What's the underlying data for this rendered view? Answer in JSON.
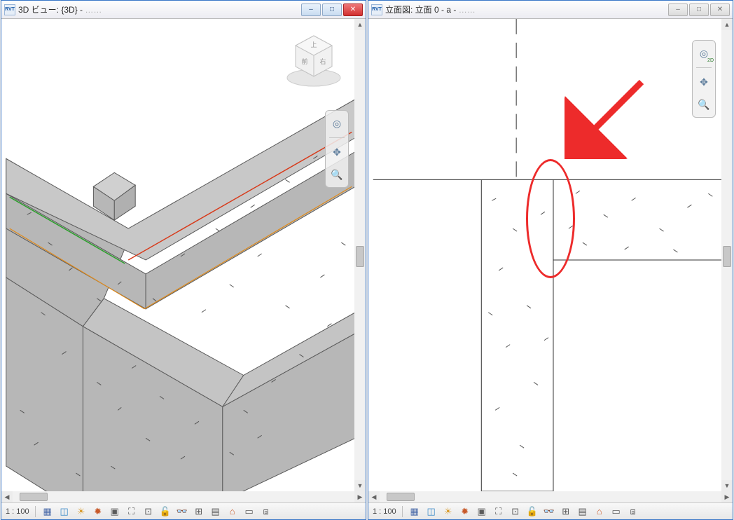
{
  "pane_left": {
    "icon_label": "RVT",
    "title": "3D ビュー: {3D} - ",
    "title_suffix": "……",
    "win_min_glyph": "–",
    "win_max_glyph": "□",
    "win_close_glyph": "✕",
    "status": {
      "scale": "1 : 100",
      "icons": [
        {
          "name": "display-style-icon",
          "glyph": "▦",
          "color": "#4a6aa8"
        },
        {
          "name": "model-display-icon",
          "glyph": "◫",
          "color": "#3a8ac8"
        },
        {
          "name": "sun-path-icon",
          "glyph": "☀",
          "color": "#d89a2a"
        },
        {
          "name": "shadows-icon",
          "glyph": "✹",
          "color": "#c85a2a"
        },
        {
          "name": "rendering-icon",
          "glyph": "▣",
          "color": "#5a5a5a"
        },
        {
          "name": "crop-view-icon",
          "glyph": "⛶",
          "color": "#5a5a5a"
        },
        {
          "name": "crop-region-icon",
          "glyph": "⊡",
          "color": "#5a5a5a"
        },
        {
          "name": "unlock-icon",
          "glyph": "🔓",
          "color": "#c89a2a"
        },
        {
          "name": "temp-hide-icon",
          "glyph": "👓",
          "color": "#5a9ac8"
        },
        {
          "name": "reveal-icon",
          "glyph": "⊞",
          "color": "#5a5a5a"
        },
        {
          "name": "properties-icon",
          "glyph": "▤",
          "color": "#5a5a5a"
        },
        {
          "name": "analytical-icon",
          "glyph": "⌂",
          "color": "#c85a2a"
        },
        {
          "name": "highlight-icon",
          "glyph": "▭",
          "color": "#5a5a5a"
        },
        {
          "name": "link-display-icon",
          "glyph": "⧈",
          "color": "#5a5a5a"
        }
      ]
    },
    "navbar": {
      "wheel_glyph": "◎",
      "pan_glyph": "✥",
      "zoom_glyph": "🔍"
    },
    "viewcube": {
      "top": "上",
      "front": "前",
      "right": "右"
    }
  },
  "pane_right": {
    "icon_label": "RVT",
    "title": "立面図: 立面 0 - a - ",
    "title_suffix": "……",
    "win_min_glyph": "–",
    "win_max_glyph": "□",
    "win_close_glyph": "✕",
    "status": {
      "scale": "1 : 100",
      "icons": [
        {
          "name": "display-style-icon",
          "glyph": "▦",
          "color": "#4a6aa8"
        },
        {
          "name": "model-display-icon",
          "glyph": "◫",
          "color": "#3a8ac8"
        },
        {
          "name": "sun-path-icon",
          "glyph": "☀",
          "color": "#d89a2a"
        },
        {
          "name": "shadows-icon",
          "glyph": "✹",
          "color": "#c85a2a"
        },
        {
          "name": "rendering-icon",
          "glyph": "▣",
          "color": "#5a5a5a"
        },
        {
          "name": "crop-view-icon",
          "glyph": "⛶",
          "color": "#5a5a5a"
        },
        {
          "name": "crop-region-icon",
          "glyph": "⊡",
          "color": "#5a5a5a"
        },
        {
          "name": "unlock-icon",
          "glyph": "🔓",
          "color": "#c89a2a"
        },
        {
          "name": "temp-hide-icon",
          "glyph": "👓",
          "color": "#5a9ac8"
        },
        {
          "name": "reveal-icon",
          "glyph": "⊞",
          "color": "#5a5a5a"
        },
        {
          "name": "properties-icon",
          "glyph": "▤",
          "color": "#5a5a5a"
        },
        {
          "name": "analytical-icon",
          "glyph": "⌂",
          "color": "#c85a2a"
        },
        {
          "name": "highlight-icon",
          "glyph": "▭",
          "color": "#5a5a5a"
        },
        {
          "name": "link-display-icon",
          "glyph": "⧈",
          "color": "#5a5a5a"
        }
      ]
    },
    "navbar": {
      "wheel_glyph": "◎",
      "wheel_sub": "2D",
      "pan_glyph": "✥",
      "zoom_glyph": "🔍"
    }
  }
}
